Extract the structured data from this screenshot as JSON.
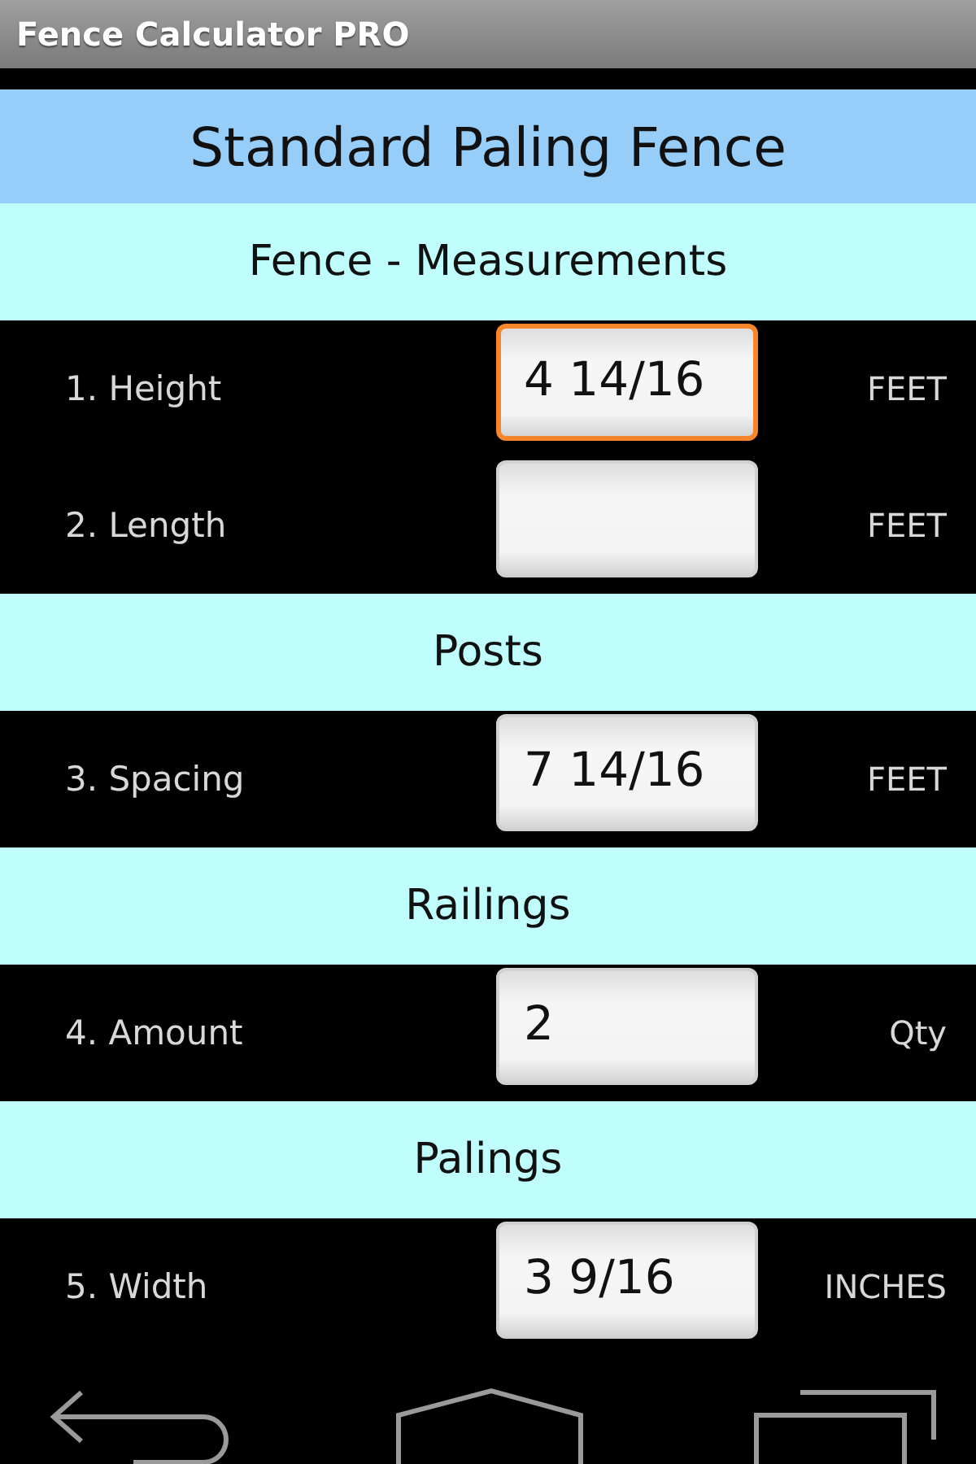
{
  "app_bar": {
    "title": "Fence Calculator PRO"
  },
  "header": {
    "title": "Standard Paling Fence"
  },
  "sections": [
    {
      "title": "Fence - Measurements",
      "fields": [
        {
          "label": "1. Height",
          "value": "4 14/16",
          "unit": "FEET",
          "focused": true
        },
        {
          "label": "2. Length",
          "unit": "FEET",
          "focused": false
        }
      ]
    },
    {
      "title": "Posts",
      "fields": [
        {
          "label": "3. Spacing",
          "value": "7 14/16",
          "unit": "FEET",
          "focused": false
        }
      ]
    },
    {
      "title": "Railings",
      "fields": [
        {
          "label": "4. Amount",
          "value": "2",
          "unit": "Qty",
          "focused": false
        }
      ]
    },
    {
      "title": "Palings",
      "fields": [
        {
          "label": "5. Width",
          "value": "3 9/16",
          "unit": "INCHES",
          "focused": false
        }
      ]
    }
  ]
}
